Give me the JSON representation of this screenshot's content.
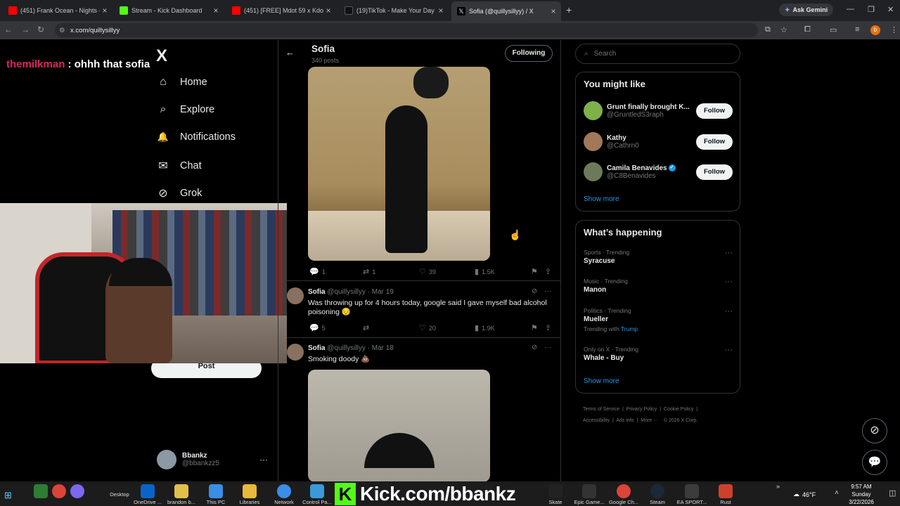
{
  "browser": {
    "tabs": [
      {
        "title": "(451) Frank Ocean - Nights - Yo",
        "icon": "youtube-icon",
        "color": "#ff0000"
      },
      {
        "title": "Stream - Kick Dashboard",
        "icon": "kick-icon",
        "color": "#53fc18"
      },
      {
        "title": "(451) [FREE] Mdot 59 x Kdotfr",
        "icon": "youtube-icon",
        "color": "#ff0000"
      },
      {
        "title": "(19)TikTok - Make Your Day",
        "icon": "tiktok-icon",
        "color": "#000000"
      },
      {
        "title": "Sofia (@quillysillyy) / X",
        "icon": "x-icon",
        "color": "#000000"
      }
    ],
    "new_tab": "+",
    "ask_gemini": "Ask Gemini",
    "url": "x.com/quillysillyy",
    "profile_initial": "b"
  },
  "stream_overlay": {
    "chat_user": "themilkman",
    "chat_text": " : ohhh that sofia"
  },
  "sidebar": {
    "logo": "X",
    "items": [
      {
        "label": "Home",
        "icon": "⌂"
      },
      {
        "label": "Explore",
        "icon": "⌕"
      },
      {
        "label": "Notifications",
        "icon": "🔔"
      },
      {
        "label": "Chat",
        "icon": "✉"
      },
      {
        "label": "Grok",
        "icon": "⊘"
      }
    ],
    "post_button": "Post",
    "account": {
      "name": "Bbankz",
      "handle": "@bbankzz5",
      "more": "···"
    }
  },
  "profile_header": {
    "back": "←",
    "name": "Sofia",
    "post_count": "340 posts",
    "following_button": "Following"
  },
  "posts": [
    {
      "stats": {
        "replies": "1",
        "reposts": "1",
        "likes": "39",
        "views": "1.5K"
      }
    },
    {
      "author": "Sofia",
      "handle": "@quillysillyy",
      "date": "· Mar 19",
      "text": "Was throwing up for 4 hours today, google said I gave myself bad alcohol poisoning 😔",
      "stats": {
        "replies": "5",
        "reposts": "",
        "likes": "20",
        "views": "1.9K"
      }
    },
    {
      "author": "Sofia",
      "handle": "@quillysillyy",
      "date": "· Mar 18",
      "text": "Smoking doody 💩"
    }
  ],
  "right": {
    "search_placeholder": "Search",
    "you_might_like": {
      "title": "You might like",
      "suggestions": [
        {
          "name": "Grunt finally brought K...",
          "handle": "@GruntledS3raph",
          "button": "Follow",
          "color": "#7fb04a"
        },
        {
          "name": "Kathy",
          "handle": "@Cathrn0",
          "button": "Follow",
          "color": "#a0785a"
        },
        {
          "name": "Camila Benavides",
          "handle": "@C8Benavides",
          "button": "Follow",
          "color": "#6d7a5a",
          "verified": true
        }
      ],
      "show_more": "Show more"
    },
    "whats_happening": {
      "title": "What’s happening",
      "trends": [
        {
          "meta": "Sports · Trending",
          "topic": "Syracuse",
          "with": ""
        },
        {
          "meta": "Music · Trending",
          "topic": "Manon",
          "with": ""
        },
        {
          "meta": "Politics · Trending",
          "topic": "Mueller",
          "with_label": "Trending with ",
          "with": "Trump"
        },
        {
          "meta": "Only on X · Trending",
          "topic": "Whale - Buy",
          "with": ""
        }
      ],
      "show_more": "Show more"
    },
    "footer": {
      "links": [
        "Terms of Service",
        "Privacy Policy",
        "Cookie Policy",
        "Accessibility",
        "Ads info",
        "More ···",
        "© 2026 X Corp."
      ]
    }
  },
  "taskbar": {
    "apps": [
      {
        "label": "",
        "color": "#2d7d32"
      },
      {
        "label": "",
        "color": "#db4437"
      },
      {
        "label": "",
        "color": "#7b68ee"
      },
      {
        "label": "Desktop",
        "color": ""
      },
      {
        "label": "OneDrive ...",
        "color": "#0a64c8"
      },
      {
        "label": "brandon b...",
        "color": "#e1c04a"
      },
      {
        "label": "This PC",
        "color": "#3a8ee6"
      },
      {
        "label": "Libraries",
        "color": "#e8b93a"
      },
      {
        "label": "Network",
        "color": "#3a8ee6"
      },
      {
        "label": "Control Pa...",
        "color": "#3a9ad9"
      }
    ],
    "apps_right": [
      {
        "label": "Skate",
        "color": "#222"
      },
      {
        "label": "Epic Game...",
        "color": "#333"
      },
      {
        "label": "Google Ch...",
        "color": "#db4437"
      },
      {
        "label": "Steam",
        "color": "#1b2838"
      },
      {
        "label": "EA SPORT...",
        "color": "#3c3c3c"
      },
      {
        "label": "Rust",
        "color": "#cd412b"
      }
    ],
    "kick_banner": "Kick.com/bbankz",
    "weather": "46°F",
    "time": "9:57 AM",
    "day": "Sunday",
    "date": "3/22/2026"
  }
}
